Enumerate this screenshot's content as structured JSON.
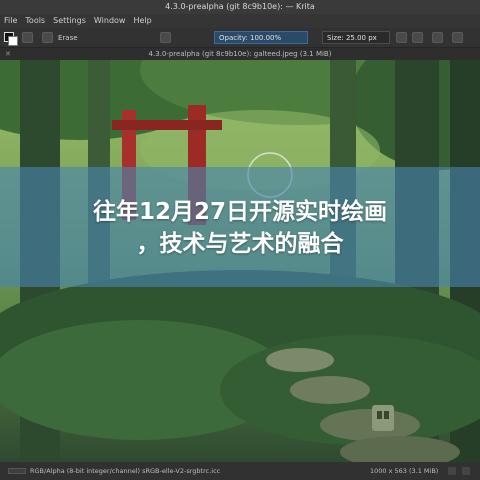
{
  "window": {
    "title": "4.3.0-prealpha (git 8c9b10e): — Krita"
  },
  "menu": {
    "items": [
      "File",
      "Tools",
      "Settings",
      "Window",
      "Help"
    ]
  },
  "tool_options": {
    "erase_label": "Erase",
    "opacity_label": "Opacity: 100.00%",
    "size_label": "Size: 25.00 px"
  },
  "document_tab": {
    "title": "4.3.0-prealpha (git 8c9b10e): galteed.jpeg (3.1 MiB)"
  },
  "banner": {
    "line1": "往年12月27日开源实时绘画",
    "line2": "，技术与艺术的融合"
  },
  "status": {
    "color_profile": "RGB/Alpha (8-bit integer/channel)  sRGB-elle-V2-srgbtrc.icc",
    "dimensions": "1000 x 563 (3.1 MiB)"
  },
  "colors": {
    "banner": "#4884b0",
    "chrome": "#323232",
    "accent": "#3c6a94"
  }
}
